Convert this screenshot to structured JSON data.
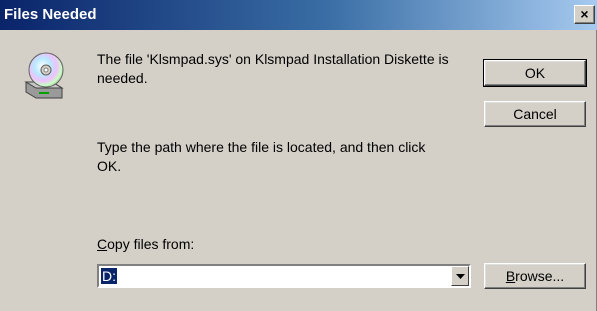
{
  "window": {
    "title": "Files Needed",
    "close_glyph": "×"
  },
  "icon": "cd-drive-icon",
  "message": {
    "line1": "The file 'Klsmpad.sys' on Klsmpad Installation Diskette is",
    "line2": "needed.",
    "instruction1": "Type the path where the file is located, and then click",
    "instruction2": "OK."
  },
  "buttons": {
    "ok": "OK",
    "cancel": "Cancel",
    "browse_underline": "B",
    "browse_rest": "rowse..."
  },
  "copy_from": {
    "label_underline": "C",
    "label_rest": "opy files from:",
    "value": "D:"
  }
}
